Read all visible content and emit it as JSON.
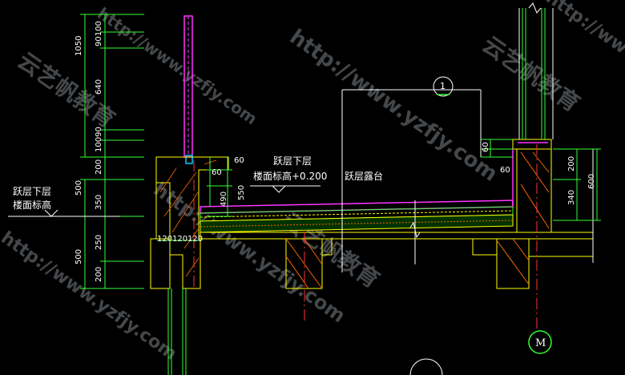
{
  "drawing": {
    "background": "#000000",
    "colors": {
      "dimension": "#33ff33",
      "concrete": "#ffff00",
      "membrane": "#ff33ff",
      "axis": "#ff3333",
      "grid": "#ffffff",
      "hatch": "#ff6600",
      "blue": "#00ccff"
    },
    "left_dims": {
      "upper_total": "1050",
      "upper_segments": [
        "90100",
        "640",
        "10090",
        "200"
      ],
      "middle_total": "500",
      "middle_segments": [
        "350"
      ],
      "lower_total": "500",
      "lower_segments": [
        "250",
        "200"
      ]
    },
    "wall_dims": [
      "120",
      "120",
      "120"
    ],
    "slab_dims": {
      "a": "60",
      "b": "60",
      "c": "490",
      "d": "550"
    },
    "right_dims": {
      "top": "60",
      "inner": "60",
      "upper": "200",
      "lower": "340",
      "total": "600"
    },
    "labels": {
      "left_level_line1": "跃层下层",
      "left_level_line2": "楼面标高",
      "center_level_line1": "跃层下层",
      "center_level_line2": "楼面标高+0.200",
      "terrace": "跃层露台"
    },
    "section_mark": "1",
    "axis_mark": "M",
    "watermarks": [
      "http://www.yzfjy.com",
      "云艺帆教育"
    ]
  }
}
